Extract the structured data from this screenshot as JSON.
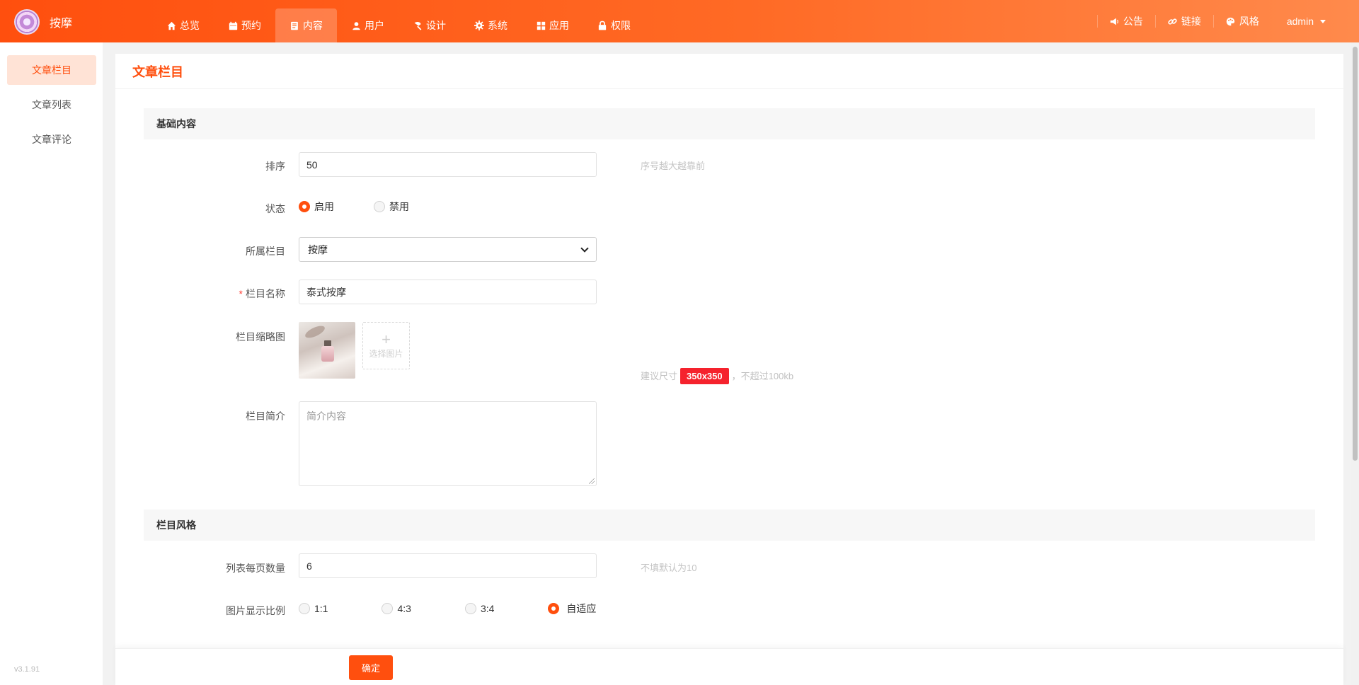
{
  "app": {
    "title": "按摩",
    "version": "v3.1.91"
  },
  "topnav": [
    {
      "label": "总览",
      "icon": "home-icon"
    },
    {
      "label": "预约",
      "icon": "calendar-icon"
    },
    {
      "label": "内容",
      "icon": "document-icon",
      "active": true
    },
    {
      "label": "用户",
      "icon": "user-icon"
    },
    {
      "label": "设计",
      "icon": "paint-brush-icon"
    },
    {
      "label": "系统",
      "icon": "gear-icon"
    },
    {
      "label": "应用",
      "icon": "grid-icon"
    },
    {
      "label": "权限",
      "icon": "lock-icon"
    }
  ],
  "topright": {
    "notice": "公告",
    "link": "链接",
    "style": "风格",
    "user": "admin"
  },
  "sidebar": {
    "items": [
      {
        "label": "文章栏目",
        "active": true
      },
      {
        "label": "文章列表"
      },
      {
        "label": "文章评论"
      }
    ]
  },
  "page": {
    "title": "文章栏目",
    "section_basic": "基础内容",
    "section_style": "栏目风格"
  },
  "form": {
    "sort": {
      "label": "排序",
      "value": "50",
      "hint": "序号越大越靠前"
    },
    "status": {
      "label": "状态",
      "options": [
        "启用",
        "禁用"
      ],
      "selected": "启用"
    },
    "parent": {
      "label": "所属栏目",
      "value": "按摩"
    },
    "name": {
      "label": "栏目名称",
      "value": "泰式按摩",
      "required": true
    },
    "thumb": {
      "label": "栏目缩略图",
      "pick_label": "选择图片",
      "hint_prefix": "建议尺寸",
      "size": "350x350",
      "hint_suffix": "，不超过100kb"
    },
    "intro": {
      "label": "栏目简介",
      "placeholder": "简介内容"
    },
    "per_page": {
      "label": "列表每页数量",
      "value": "6",
      "hint": "不填默认为10"
    },
    "ratio": {
      "label": "图片显示比例",
      "options": [
        "1:1",
        "4:3",
        "3:4",
        "自适应"
      ],
      "selected": "自适应"
    }
  },
  "actions": {
    "confirm": "确定"
  },
  "colors": {
    "accent": "#ff4f0e",
    "badge": "#f5222d"
  }
}
